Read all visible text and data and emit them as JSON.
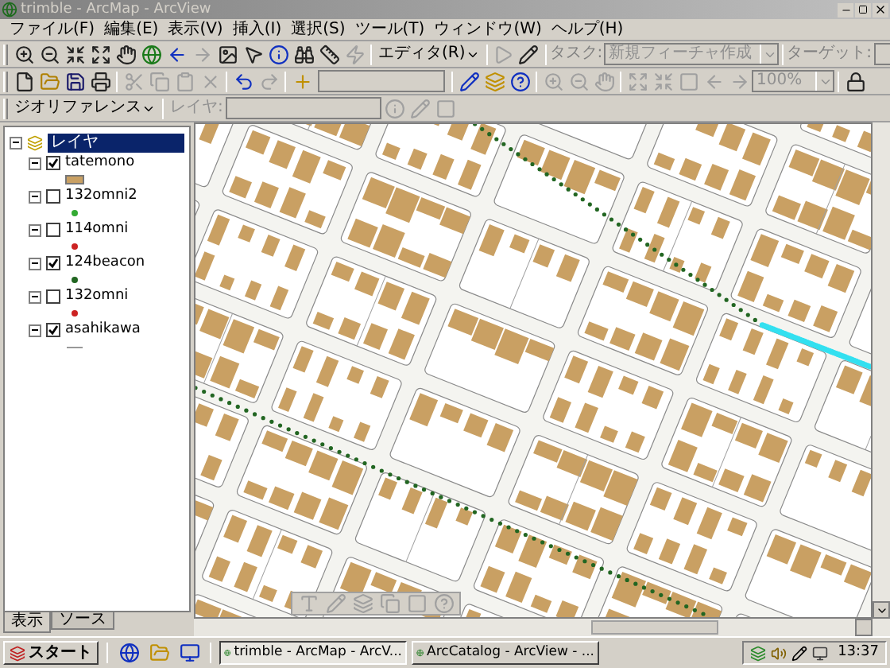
{
  "window": {
    "title": "trimble - ArcMap - ArcView"
  },
  "menu": [
    {
      "label": "ファイル(F)"
    },
    {
      "label": "編集(E)"
    },
    {
      "label": "表示(V)"
    },
    {
      "label": "挿入(I)"
    },
    {
      "label": "選択(S)"
    },
    {
      "label": "ツール(T)"
    },
    {
      "label": "ウィンドウ(W)"
    },
    {
      "label": "ヘルプ(H)"
    }
  ],
  "editor_toolbar": {
    "editor_menu": "エディタ(R)",
    "task_label": "タスク:",
    "task": {
      "value": "新規フィーチャ作成",
      "disabled": true
    },
    "target_label": "ターゲット:"
  },
  "standard_toolbar": {
    "scale": {
      "value": "100%",
      "disabled": true
    }
  },
  "georef_toolbar": {
    "menu": "ジオリファレンス",
    "layer_label": "レイヤ:",
    "layer_disabled": true
  },
  "toc": {
    "root": {
      "label": "レイヤ",
      "selected": true,
      "expanded": true
    },
    "layers": [
      {
        "name": "tatemono",
        "checked": true,
        "expanded": true,
        "legend": {
          "kind": "fill",
          "color": "#c9a063"
        }
      },
      {
        "name": "132omni2",
        "checked": false,
        "expanded": true,
        "legend": {
          "kind": "point",
          "color": "#33aa33"
        }
      },
      {
        "name": "114omni",
        "checked": false,
        "expanded": true,
        "legend": {
          "kind": "point",
          "color": "#cc2222"
        }
      },
      {
        "name": "124beacon",
        "checked": true,
        "expanded": true,
        "legend": {
          "kind": "point",
          "color": "#226622"
        }
      },
      {
        "name": "132omni",
        "checked": false,
        "expanded": true,
        "legend": {
          "kind": "point",
          "color": "#cc2222"
        }
      },
      {
        "name": "asahikawa",
        "checked": true,
        "expanded": true,
        "legend": {
          "kind": "line",
          "color": "#999999"
        }
      }
    ]
  },
  "toc_tabs": [
    {
      "label": "表示",
      "selected": true
    },
    {
      "label": "ソース",
      "selected": false
    }
  ],
  "taskbar": {
    "start": "スタート",
    "tasks": [
      {
        "label": "trimble - ArcMap - ArcV...",
        "selected": true
      },
      {
        "label": "ArcCatalog - ArcView - ...",
        "selected": false
      }
    ],
    "clock": "13:37"
  }
}
